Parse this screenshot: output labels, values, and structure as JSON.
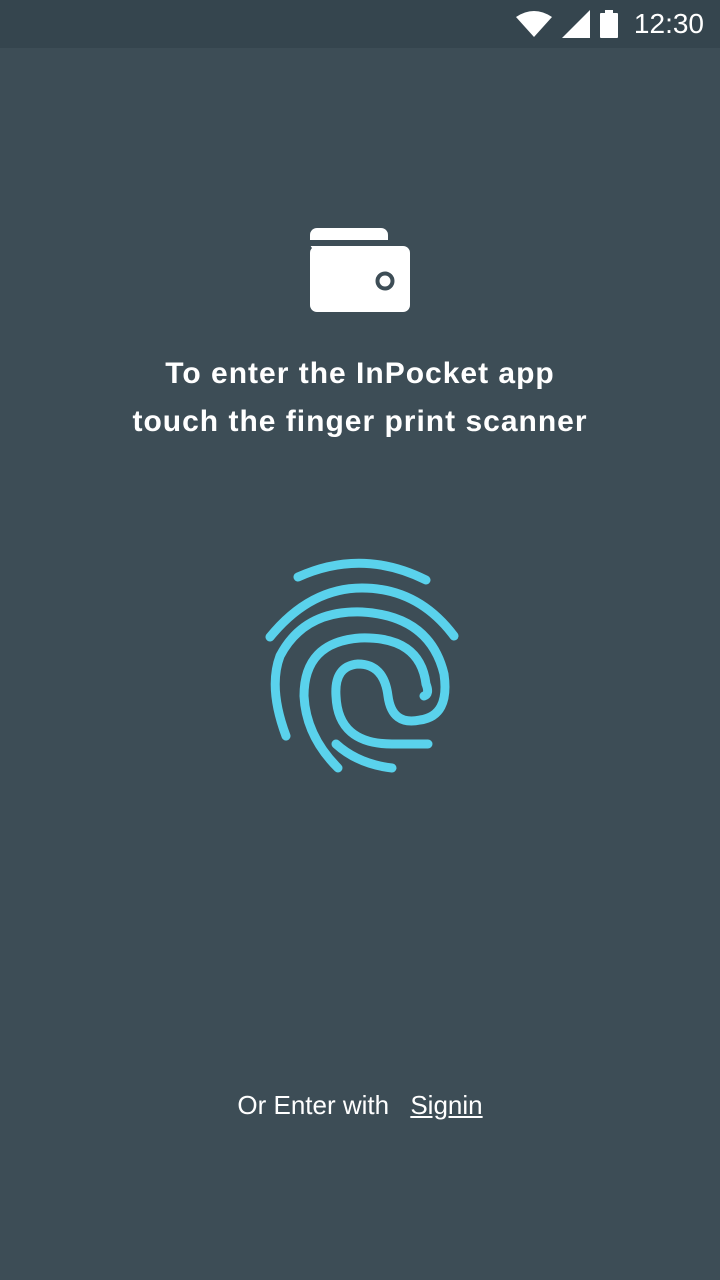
{
  "status_bar": {
    "time": "12:30",
    "icons": [
      "wifi-icon",
      "cellular-signal-icon",
      "battery-icon"
    ]
  },
  "header": {
    "icon": "wallet-icon",
    "line1": "To enter the InPocket app",
    "line2": "touch the finger print scanner"
  },
  "scanner": {
    "icon": "fingerprint-icon",
    "color": "#5ad2ec"
  },
  "footer": {
    "prefix": "Or Enter with",
    "signin_label": "Signin"
  },
  "colors": {
    "background": "#3d4d56",
    "status_bar": "#35454e",
    "accent": "#5ad2ec",
    "text": "#ffffff"
  }
}
